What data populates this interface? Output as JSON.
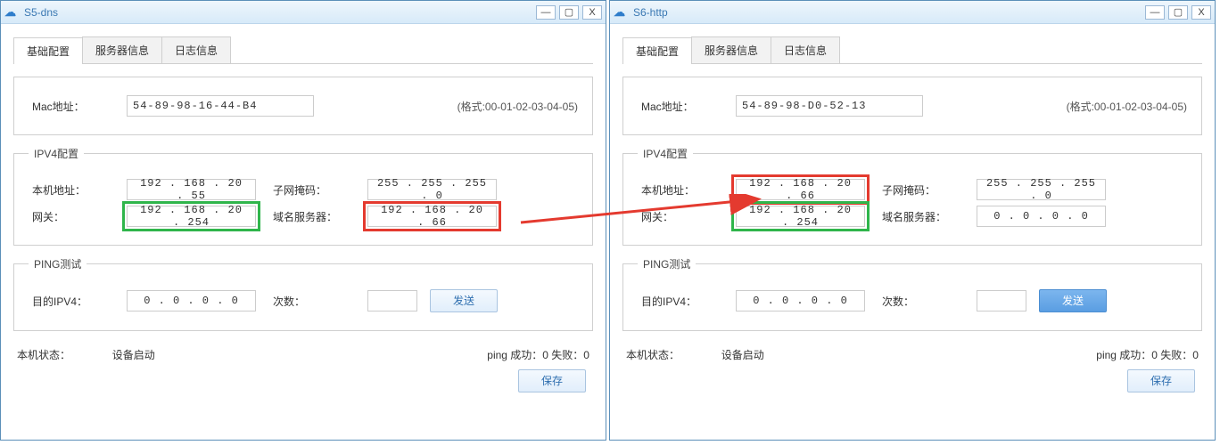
{
  "windows": [
    {
      "id": "win1",
      "title": "S5-dns",
      "tabs": [
        "基础配置",
        "服务器信息",
        "日志信息"
      ],
      "mac_label": "Mac地址：",
      "mac": "54-89-98-16-44-B4",
      "mac_fmt": "(格式:00-01-02-03-04-05)",
      "ipv4_legend": "IPV4配置",
      "ip_label": "本机地址：",
      "ip": "192 . 168 .  20 .  55",
      "mask_label": "子网掩码：",
      "mask": "255 . 255 . 255 .  0",
      "gw_label": "网关：",
      "gw": "192 . 168 .  20 . 254",
      "dns_label": "域名服务器：",
      "dns": "192 . 168 .  20 .  66",
      "ping_legend": "PING测试",
      "dest_label": "目的IPV4：",
      "dest": "0  .  0  .  0  .  0",
      "count_label": "次数：",
      "count": "",
      "send_btn": "发送",
      "status_label": "本机状态：",
      "status": "设备启动",
      "ping_result": "ping 成功：0 失败：0",
      "save_btn": "保存",
      "hl": {
        "ip": "",
        "gw": "green",
        "dns": "red"
      }
    },
    {
      "id": "win2",
      "title": "S6-http",
      "tabs": [
        "基础配置",
        "服务器信息",
        "日志信息"
      ],
      "mac_label": "Mac地址：",
      "mac": "54-89-98-D0-52-13",
      "mac_fmt": "(格式:00-01-02-03-04-05)",
      "ipv4_legend": "IPV4配置",
      "ip_label": "本机地址：",
      "ip": "192 . 168 .  20 .  66",
      "mask_label": "子网掩码：",
      "mask": "255 . 255 . 255 .  0",
      "gw_label": "网关：",
      "gw": "192 . 168 .  20 . 254",
      "dns_label": "域名服务器：",
      "dns": "0  .  0  .  0  .  0",
      "ping_legend": "PING测试",
      "dest_label": "目的IPV4：",
      "dest": "0  .  0  .  0  .  0",
      "count_label": "次数：",
      "count": "",
      "send_btn": "发送",
      "status_label": "本机状态：",
      "status": "设备启动",
      "ping_result": "ping 成功：0 失败：0",
      "save_btn": "保存",
      "hl": {
        "ip": "red",
        "gw": "green",
        "dns": ""
      }
    }
  ],
  "win_buttons": {
    "min": "—",
    "max": "▢",
    "close": "X"
  }
}
